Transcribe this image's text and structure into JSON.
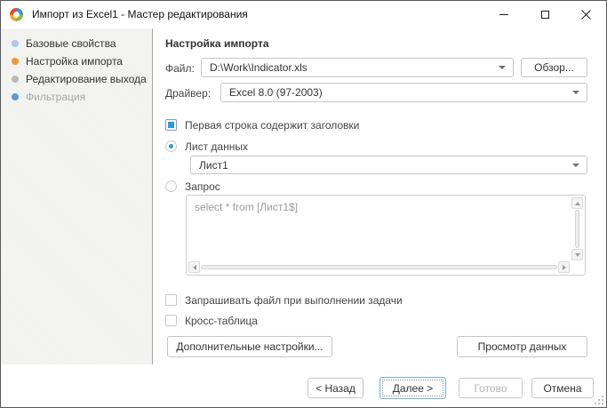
{
  "window": {
    "title": "Импорт из Excel1 - Мастер редактирования"
  },
  "sidebar": {
    "steps": [
      {
        "label": "Базовые свойства",
        "bullet": "#abc9ec",
        "disabled": false
      },
      {
        "label": "Настройка импорта",
        "bullet": "#f09a36",
        "disabled": false
      },
      {
        "label": "Редактирование выхода",
        "bullet": "#bababa",
        "disabled": false
      },
      {
        "label": "Фильтрация",
        "bullet": "#5b9bd5",
        "disabled": true
      }
    ]
  },
  "main": {
    "heading": "Настройка импорта",
    "file": {
      "label": "Файл:",
      "value": "D:\\Work\\Indicator.xls"
    },
    "browse_button": "Обзор...",
    "driver": {
      "label": "Драйвер:",
      "value": "Excel 8.0 (97-2003)"
    },
    "first_row": {
      "label": "Первая строка содержит заголовки",
      "checked": true
    },
    "sheet": {
      "label": "Лист данных",
      "selected": true,
      "value": "Лист1"
    },
    "query": {
      "label": "Запрос",
      "selected": false,
      "text": "select * from [Лист1$]"
    },
    "prompt_file": {
      "label": "Запрашивать файл при выполнении задачи",
      "checked": false
    },
    "cross_table": {
      "label": "Кросс-таблица",
      "checked": false
    },
    "advanced_button": "Дополнительные настройки...",
    "preview_button": "Просмотр данных"
  },
  "footer": {
    "back": "< Назад",
    "next": "Далее >",
    "finish": "Готово",
    "finish_disabled": true,
    "cancel": "Отмена"
  },
  "colors": {
    "accent_blue": "#2e9ad8",
    "active_step_orange": "#f09a36",
    "focus_border": "#70aee2",
    "disabled_text": "#a6a6a6",
    "window_border": "#595959"
  }
}
